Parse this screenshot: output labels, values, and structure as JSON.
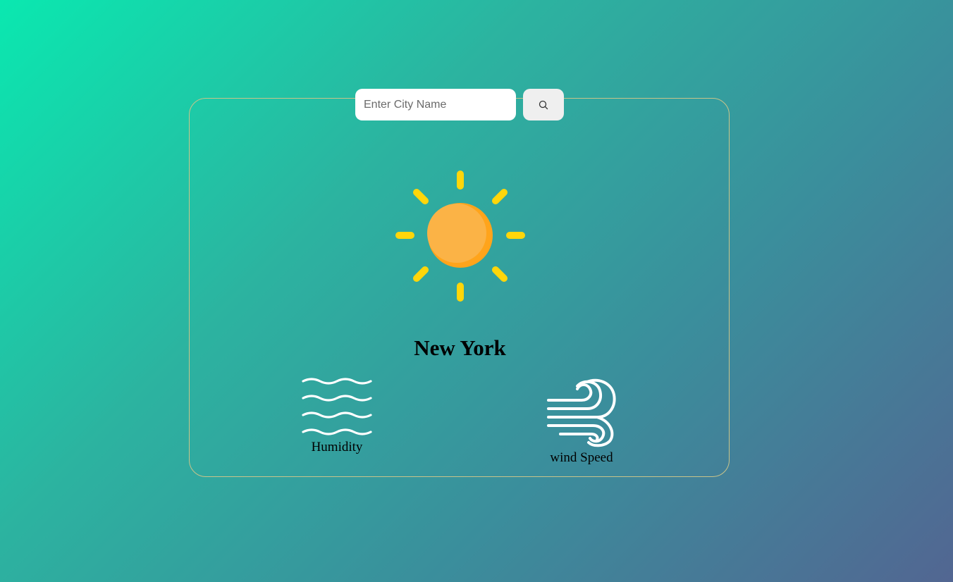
{
  "search": {
    "placeholder": "Enter City Name",
    "value": "",
    "button_icon": "search-icon"
  },
  "weather": {
    "icon": "sun-icon",
    "city": "New York"
  },
  "details": {
    "humidity": {
      "icon": "humidity-waves-icon",
      "label": "Humidity"
    },
    "wind": {
      "icon": "wind-icon",
      "label": "wind Speed"
    }
  },
  "colors": {
    "sun_body": "#fbb03b",
    "sun_rays": "#ffd60a",
    "card_border": "#c9c48a"
  }
}
